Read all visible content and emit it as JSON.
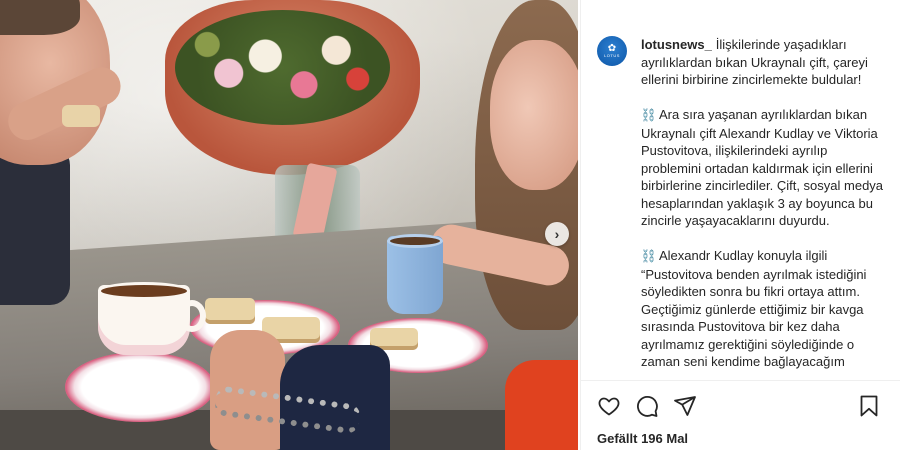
{
  "post": {
    "username": "lotusnews_",
    "avatar": {
      "logo_glyph": "✿",
      "logo_text": "LOTUS",
      "color": "#1565c0"
    },
    "caption_paragraphs": [
      {
        "emoji": "",
        "text": "İlişkilerinde yaşadıkları ayrılıklardan bıkan Ukraynalı çift, çareyi ellerini birbirine zincirlemekte buldular!"
      },
      {
        "emoji": "⛓️",
        "text": "Ara sıra yaşanan ayrılıklardan bıkan Ukraynalı çift Alexandr Kudlay ve Viktoria Pustovitova, ilişkilerindeki ayrılıp problemini ortadan kaldırmak için ellerini birbirlerine zincirlediler. Çift, sosyal medya hesaplarından yaklaşık 3 ay boyunca bu zincirle yaşayacaklarını duyurdu."
      },
      {
        "emoji": "⛓️",
        "text": "Alexandr Kudlay konuyla ilgili “Pustovitova benden ayrılmak istediğini söyledikten sonra bu fikri ortaya attım. Geçtiğimiz günlerde ettiğimiz bir kavga sırasında Pustovitova bir kez daha ayrılmamız gerektiğini söylediğinde o zaman seni kendime bağlayacağım"
      }
    ],
    "likes_text": "Gefällt 196 Mal"
  },
  "photo": {
    "next_arrow": "›"
  },
  "icons": {
    "like": "heart-icon",
    "comment": "comment-bubble-icon",
    "share": "paper-plane-icon",
    "save": "bookmark-icon"
  }
}
